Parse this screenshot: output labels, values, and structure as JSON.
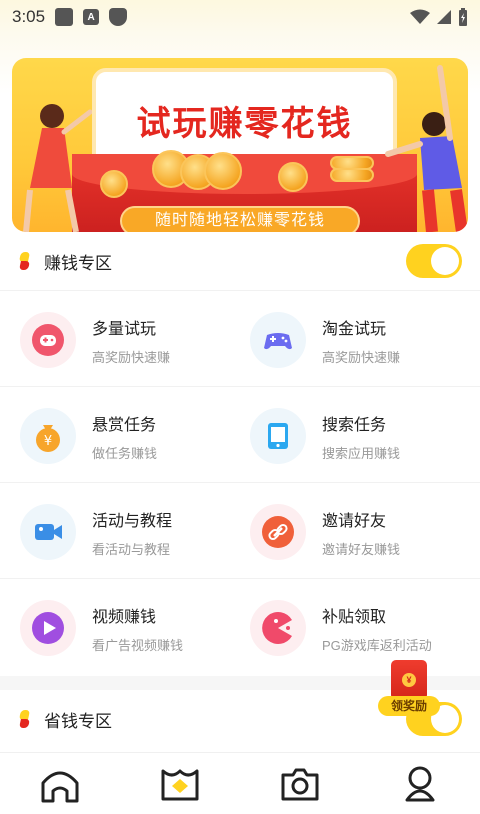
{
  "status_bar": {
    "time": "3:05",
    "badge_letter": "A"
  },
  "banner": {
    "title": "试玩赚零花钱",
    "subtitle": "随时随地轻松赚零花钱"
  },
  "earn_section": {
    "label": "赚钱专区",
    "toggle_on": true
  },
  "earn_items": [
    {
      "title": "多量试玩",
      "subtitle": "高奖励快速赚",
      "icon": "gamepad-icon",
      "color": "#f0566c"
    },
    {
      "title": "淘金试玩",
      "subtitle": "高奖励快速赚",
      "icon": "controller-icon",
      "color": "#6b6cf0"
    },
    {
      "title": "悬赏任务",
      "subtitle": "做任务赚钱",
      "icon": "money-bag-icon",
      "color": "#f7a52b"
    },
    {
      "title": "搜索任务",
      "subtitle": "搜索应用赚钱",
      "icon": "tablet-icon",
      "color": "#2ba8f0"
    },
    {
      "title": "活动与教程",
      "subtitle": "看活动与教程",
      "icon": "video-camera-icon",
      "color": "#3a8ee6"
    },
    {
      "title": "邀请好友",
      "subtitle": "邀请好友赚钱",
      "icon": "link-icon",
      "color": "#f0603a"
    },
    {
      "title": "视频赚钱",
      "subtitle": "看广告视频赚钱",
      "icon": "play-icon",
      "color": "#a04ee0"
    },
    {
      "title": "补贴领取",
      "subtitle": "PG游戏库返利活动",
      "icon": "pacman-icon",
      "color": "#f04a6a"
    }
  ],
  "save_section": {
    "label": "省钱专区",
    "toggle_on": true
  },
  "reward_float": {
    "label": "领奖励",
    "coin_symbol": "¥"
  },
  "bag_symbol": "¥",
  "tabs": [
    {
      "name": "home",
      "icon": "home-icon"
    },
    {
      "name": "earn",
      "icon": "store-icon"
    },
    {
      "name": "camera",
      "icon": "camera-icon"
    },
    {
      "name": "profile",
      "icon": "profile-icon"
    }
  ],
  "colors": {
    "accent": "#ffd21f",
    "red": "#e4271f"
  }
}
